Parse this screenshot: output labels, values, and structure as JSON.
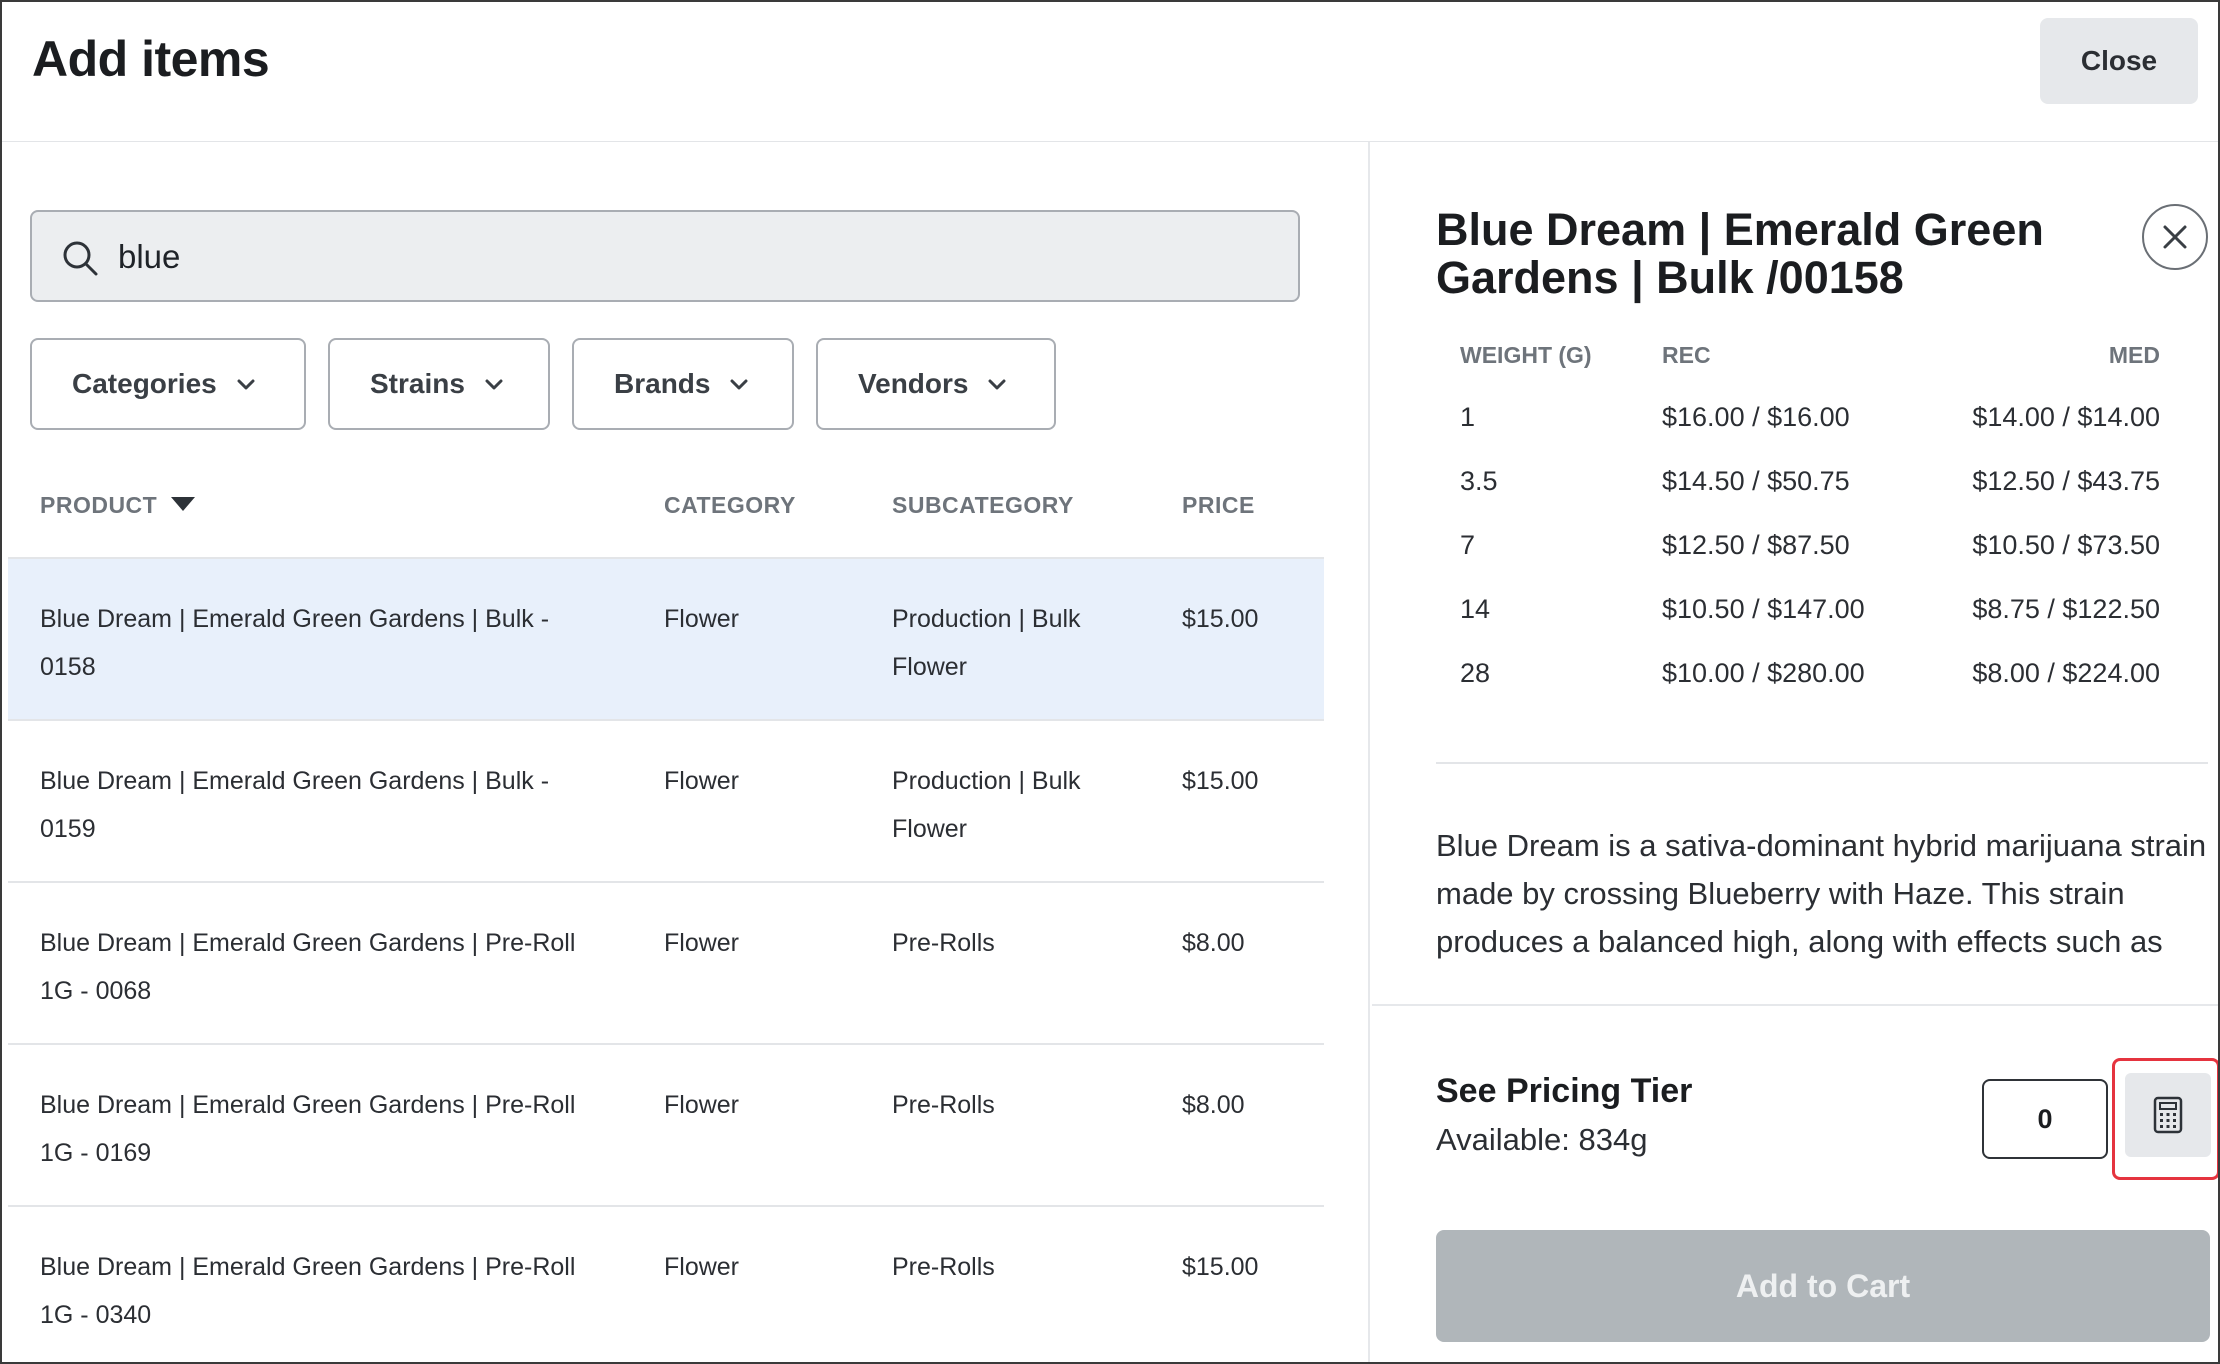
{
  "header": {
    "title": "Add items",
    "close_label": "Close"
  },
  "search": {
    "value": "blue",
    "placeholder": ""
  },
  "filters": [
    {
      "label": "Categories"
    },
    {
      "label": "Strains"
    },
    {
      "label": "Brands"
    },
    {
      "label": "Vendors"
    }
  ],
  "table": {
    "columns": {
      "product": "PRODUCT",
      "category": "CATEGORY",
      "subcategory": "SUBCATEGORY",
      "price": "PRICE"
    },
    "rows": [
      {
        "product": "Blue Dream | Emerald Green Gardens | Bulk - 0158",
        "category": "Flower",
        "subcategory": "Production | Bulk Flower",
        "price": "$15.00",
        "selected": true
      },
      {
        "product": "Blue Dream | Emerald Green Gardens | Bulk - 0159",
        "category": "Flower",
        "subcategory": "Production | Bulk Flower",
        "price": "$15.00"
      },
      {
        "product": "Blue Dream | Emerald Green Gardens | Pre-Roll 1G - 0068",
        "category": "Flower",
        "subcategory": "Pre-Rolls",
        "price": "$8.00"
      },
      {
        "product": "Blue Dream | Emerald Green Gardens | Pre-Roll 1G - 0169",
        "category": "Flower",
        "subcategory": "Pre-Rolls",
        "price": "$8.00"
      },
      {
        "product": "Blue Dream | Emerald Green Gardens | Pre-Roll 1G - 0340",
        "category": "Flower",
        "subcategory": "Pre-Rolls",
        "price": "$15.00"
      }
    ]
  },
  "detail": {
    "title": "Blue Dream | Emerald Green Gardens | Bulk /00158",
    "pricing_headers": {
      "weight": "WEIGHT (G)",
      "rec": "REC",
      "med": "MED"
    },
    "pricing": [
      {
        "weight": "1",
        "rec": "$16.00 / $16.00",
        "med": "$14.00 / $14.00"
      },
      {
        "weight": "3.5",
        "rec": "$14.50 / $50.75",
        "med": "$12.50 / $43.75"
      },
      {
        "weight": "7",
        "rec": "$12.50 / $87.50",
        "med": "$10.50 / $73.50"
      },
      {
        "weight": "14",
        "rec": "$10.50 / $147.00",
        "med": "$8.75 / $122.50"
      },
      {
        "weight": "28",
        "rec": "$10.00 / $280.00",
        "med": "$8.00 / $224.00"
      }
    ],
    "description": "Blue Dream is a sativa-dominant hybrid marijuana strain made by crossing Blueberry with Haze. This strain produces a balanced high, along with effects such as cerebral stimulation and full-body relaxation.",
    "tier_label": "See Pricing Tier",
    "available": "Available: 834g",
    "quantity": "0",
    "add_to_cart_label": "Add to Cart"
  },
  "colors": {
    "selected_row": "#e8f0fb",
    "highlight_border": "#e5343f",
    "disabled_button": "#b0b6ba"
  },
  "icons": {
    "search": "search-icon",
    "chevron": "chevron-down-icon",
    "close": "close-icon",
    "calculator": "calculator-icon"
  }
}
